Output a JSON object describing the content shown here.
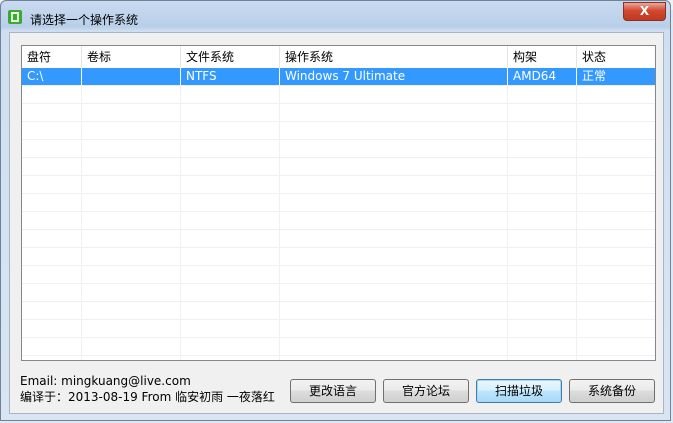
{
  "window": {
    "title": "请选择一个操作系统",
    "close_label": "X"
  },
  "table": {
    "headers": [
      "盘符",
      "卷标",
      "文件系统",
      "操作系统",
      "构架",
      "状态"
    ],
    "rows": [
      [
        "C:\\",
        "",
        "NTFS",
        "Windows 7 Ultimate",
        "AMD64",
        "正常"
      ]
    ],
    "selected_row": 0
  },
  "footer": {
    "email_line": "Email: mingkuang@live.com",
    "compiled_line": "编译于：2013-08-19 From 临安初雨 一夜落红"
  },
  "buttons": {
    "change_language": "更改语言",
    "official_forum": "官方论坛",
    "scan_junk": "扫描垃圾",
    "system_backup": "系统备份"
  },
  "colors": {
    "selection": "#3399ff",
    "close_button": "#d2472f"
  },
  "icons": {
    "app": "app-icon",
    "close": "close-icon"
  }
}
